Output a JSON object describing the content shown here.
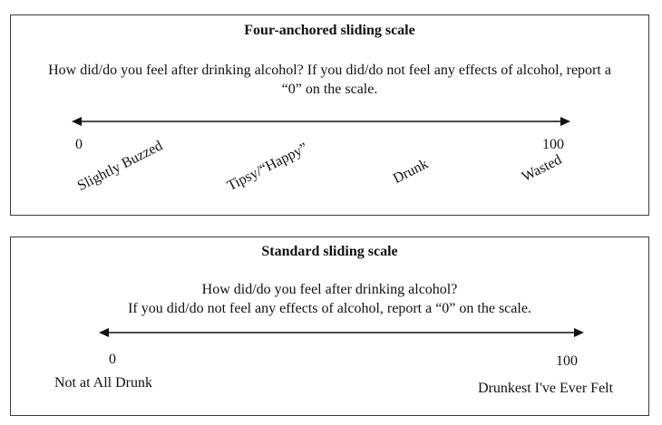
{
  "four_anchored": {
    "title": "Four-anchored sliding scale",
    "question_line1": "How did/do you feel after drinking alcohol? If you did/do not feel any effects of alcohol, report a",
    "question_line2": "“0” on the scale.",
    "min_label": "0",
    "max_label": "100",
    "anchors": [
      "Slightly Buzzed",
      "Tipsy/“Happy”",
      "Drunk",
      "Wasted"
    ]
  },
  "standard": {
    "title": "Standard sliding scale",
    "question_line1": "How did/do you feel after drinking alcohol?",
    "question_line2": "If you did/do not feel any effects of alcohol, report a “0” on the scale.",
    "min_label": "0",
    "max_label": "100",
    "min_anchor": "Not at All Drunk",
    "max_anchor": "Drunkest I've Ever Felt"
  }
}
